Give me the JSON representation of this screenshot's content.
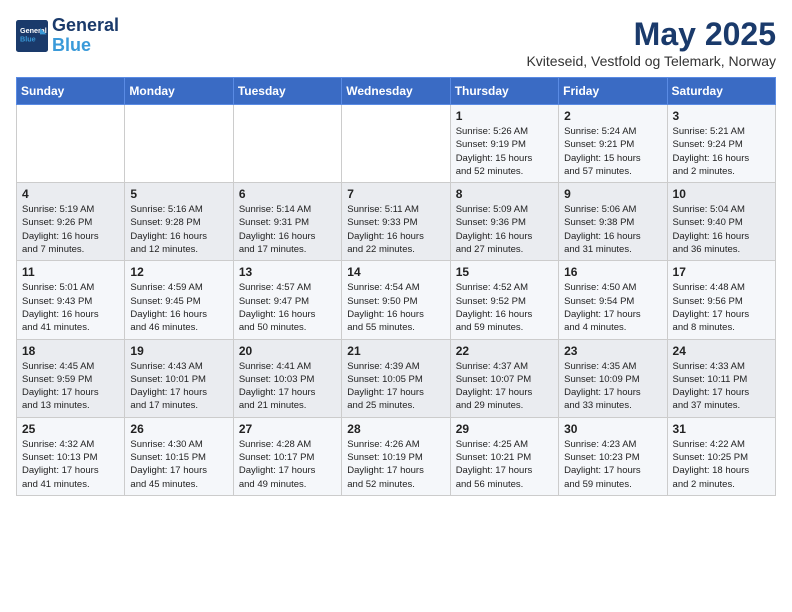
{
  "logo": {
    "line1": "General",
    "line2": "Blue"
  },
  "title": "May 2025",
  "location": "Kviteseid, Vestfold og Telemark, Norway",
  "days_header": [
    "Sunday",
    "Monday",
    "Tuesday",
    "Wednesday",
    "Thursday",
    "Friday",
    "Saturday"
  ],
  "weeks": [
    [
      {
        "day": "",
        "content": ""
      },
      {
        "day": "",
        "content": ""
      },
      {
        "day": "",
        "content": ""
      },
      {
        "day": "",
        "content": ""
      },
      {
        "day": "1",
        "content": "Sunrise: 5:26 AM\nSunset: 9:19 PM\nDaylight: 15 hours\nand 52 minutes."
      },
      {
        "day": "2",
        "content": "Sunrise: 5:24 AM\nSunset: 9:21 PM\nDaylight: 15 hours\nand 57 minutes."
      },
      {
        "day": "3",
        "content": "Sunrise: 5:21 AM\nSunset: 9:24 PM\nDaylight: 16 hours\nand 2 minutes."
      }
    ],
    [
      {
        "day": "4",
        "content": "Sunrise: 5:19 AM\nSunset: 9:26 PM\nDaylight: 16 hours\nand 7 minutes."
      },
      {
        "day": "5",
        "content": "Sunrise: 5:16 AM\nSunset: 9:28 PM\nDaylight: 16 hours\nand 12 minutes."
      },
      {
        "day": "6",
        "content": "Sunrise: 5:14 AM\nSunset: 9:31 PM\nDaylight: 16 hours\nand 17 minutes."
      },
      {
        "day": "7",
        "content": "Sunrise: 5:11 AM\nSunset: 9:33 PM\nDaylight: 16 hours\nand 22 minutes."
      },
      {
        "day": "8",
        "content": "Sunrise: 5:09 AM\nSunset: 9:36 PM\nDaylight: 16 hours\nand 27 minutes."
      },
      {
        "day": "9",
        "content": "Sunrise: 5:06 AM\nSunset: 9:38 PM\nDaylight: 16 hours\nand 31 minutes."
      },
      {
        "day": "10",
        "content": "Sunrise: 5:04 AM\nSunset: 9:40 PM\nDaylight: 16 hours\nand 36 minutes."
      }
    ],
    [
      {
        "day": "11",
        "content": "Sunrise: 5:01 AM\nSunset: 9:43 PM\nDaylight: 16 hours\nand 41 minutes."
      },
      {
        "day": "12",
        "content": "Sunrise: 4:59 AM\nSunset: 9:45 PM\nDaylight: 16 hours\nand 46 minutes."
      },
      {
        "day": "13",
        "content": "Sunrise: 4:57 AM\nSunset: 9:47 PM\nDaylight: 16 hours\nand 50 minutes."
      },
      {
        "day": "14",
        "content": "Sunrise: 4:54 AM\nSunset: 9:50 PM\nDaylight: 16 hours\nand 55 minutes."
      },
      {
        "day": "15",
        "content": "Sunrise: 4:52 AM\nSunset: 9:52 PM\nDaylight: 16 hours\nand 59 minutes."
      },
      {
        "day": "16",
        "content": "Sunrise: 4:50 AM\nSunset: 9:54 PM\nDaylight: 17 hours\nand 4 minutes."
      },
      {
        "day": "17",
        "content": "Sunrise: 4:48 AM\nSunset: 9:56 PM\nDaylight: 17 hours\nand 8 minutes."
      }
    ],
    [
      {
        "day": "18",
        "content": "Sunrise: 4:45 AM\nSunset: 9:59 PM\nDaylight: 17 hours\nand 13 minutes."
      },
      {
        "day": "19",
        "content": "Sunrise: 4:43 AM\nSunset: 10:01 PM\nDaylight: 17 hours\nand 17 minutes."
      },
      {
        "day": "20",
        "content": "Sunrise: 4:41 AM\nSunset: 10:03 PM\nDaylight: 17 hours\nand 21 minutes."
      },
      {
        "day": "21",
        "content": "Sunrise: 4:39 AM\nSunset: 10:05 PM\nDaylight: 17 hours\nand 25 minutes."
      },
      {
        "day": "22",
        "content": "Sunrise: 4:37 AM\nSunset: 10:07 PM\nDaylight: 17 hours\nand 29 minutes."
      },
      {
        "day": "23",
        "content": "Sunrise: 4:35 AM\nSunset: 10:09 PM\nDaylight: 17 hours\nand 33 minutes."
      },
      {
        "day": "24",
        "content": "Sunrise: 4:33 AM\nSunset: 10:11 PM\nDaylight: 17 hours\nand 37 minutes."
      }
    ],
    [
      {
        "day": "25",
        "content": "Sunrise: 4:32 AM\nSunset: 10:13 PM\nDaylight: 17 hours\nand 41 minutes."
      },
      {
        "day": "26",
        "content": "Sunrise: 4:30 AM\nSunset: 10:15 PM\nDaylight: 17 hours\nand 45 minutes."
      },
      {
        "day": "27",
        "content": "Sunrise: 4:28 AM\nSunset: 10:17 PM\nDaylight: 17 hours\nand 49 minutes."
      },
      {
        "day": "28",
        "content": "Sunrise: 4:26 AM\nSunset: 10:19 PM\nDaylight: 17 hours\nand 52 minutes."
      },
      {
        "day": "29",
        "content": "Sunrise: 4:25 AM\nSunset: 10:21 PM\nDaylight: 17 hours\nand 56 minutes."
      },
      {
        "day": "30",
        "content": "Sunrise: 4:23 AM\nSunset: 10:23 PM\nDaylight: 17 hours\nand 59 minutes."
      },
      {
        "day": "31",
        "content": "Sunrise: 4:22 AM\nSunset: 10:25 PM\nDaylight: 18 hours\nand 2 minutes."
      }
    ]
  ]
}
